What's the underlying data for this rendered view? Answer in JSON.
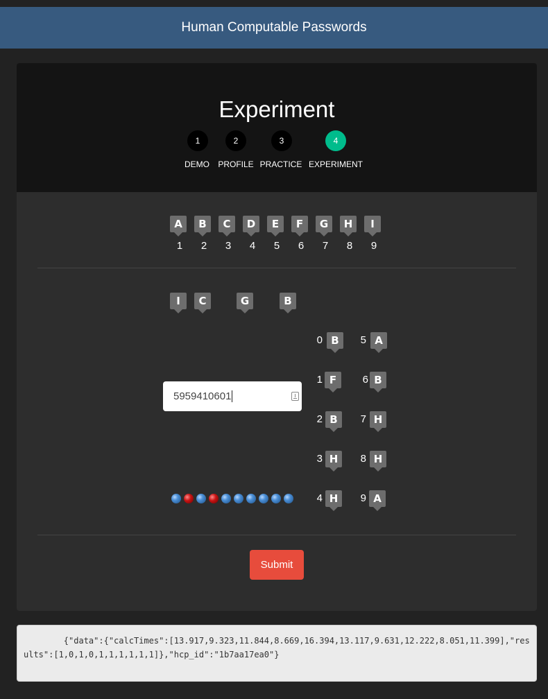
{
  "navbar": {
    "title": "Human Computable Passwords"
  },
  "card": {
    "title": "Experiment"
  },
  "steps": [
    {
      "number": "1",
      "label": "DEMO",
      "active": false
    },
    {
      "number": "2",
      "label": "PROFILE",
      "active": false
    },
    {
      "number": "3",
      "label": "PRACTICE",
      "active": false
    },
    {
      "number": "4",
      "label": "EXPERIMENT",
      "active": true
    }
  ],
  "mapping": {
    "letters": [
      "A",
      "B",
      "C",
      "D",
      "E",
      "F",
      "G",
      "H",
      "I"
    ],
    "numbers": [
      "1",
      "2",
      "3",
      "4",
      "5",
      "6",
      "7",
      "8",
      "9"
    ]
  },
  "challenge": {
    "top_letters": [
      "I",
      "C",
      "G",
      "B"
    ],
    "left_column": [
      {
        "digit": "0",
        "letter": "B"
      },
      {
        "digit": "1",
        "letter": "F"
      },
      {
        "digit": "2",
        "letter": "B"
      },
      {
        "digit": "3",
        "letter": "H"
      },
      {
        "digit": "4",
        "letter": "H"
      }
    ],
    "right_column": [
      {
        "digit": "5",
        "letter": "A"
      },
      {
        "digit": "6",
        "letter": "B"
      },
      {
        "digit": "7",
        "letter": "H"
      },
      {
        "digit": "8",
        "letter": "H"
      },
      {
        "digit": "9",
        "letter": "A"
      }
    ]
  },
  "answer_input": {
    "value": "5959410601"
  },
  "progress_results": [
    1,
    0,
    1,
    0,
    1,
    1,
    1,
    1,
    1,
    1
  ],
  "submit": {
    "label": "Submit"
  },
  "output_json": "        {\"data\":{\"calcTimes\":[13.917,9.323,11.844,8.669,16.394,13.117,9.631,12.222,8.051,11.399],\"results\":[1,0,1,0,1,1,1,1,1,1]},\"hcp_id\":\"1b7aa17ea0\"}",
  "colors": {
    "navbar": "#375a7f",
    "active_step": "#00bc8c",
    "submit": "#e74c3c",
    "correct_dot": "#4b8fd6",
    "wrong_dot": "#c81414"
  }
}
